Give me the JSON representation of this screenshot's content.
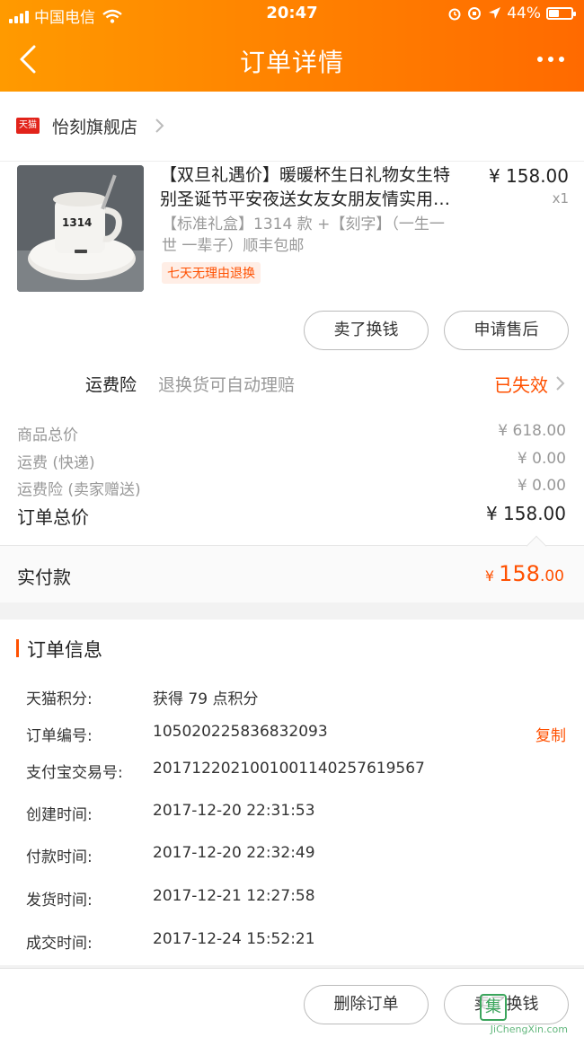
{
  "status_bar": {
    "carrier": "中国电信",
    "time": "20:47",
    "battery": "44%",
    "battery_level": 0.44
  },
  "nav": {
    "title": "订单详情",
    "icons": [
      "back-chevron-icon",
      "more-dots-icon"
    ]
  },
  "shop": {
    "badge": "天猫",
    "name": "怡刻旗舰店"
  },
  "product": {
    "title_line1": "【双旦礼遇价】暖暖杯生日礼物女生特",
    "title_line2": "别圣诞节平安夜送女友女朋友情实用…",
    "price": "¥ 158.00",
    "quantity": "x1",
    "sku_line1": "【标准礼盒】1314 款 +【刻字】（一生一",
    "sku_line2": "世 一辈子）顺丰包邮",
    "tag": "七天无理由退换",
    "mug_label": "1314"
  },
  "item_actions": {
    "sell": "卖了换钱",
    "after_sale": "申请售后"
  },
  "insurance": {
    "label": "运费险",
    "desc": "退换货可自动理赔",
    "status": "已失效"
  },
  "fees": {
    "goods_label": "商品总价",
    "goods_value": "¥ 618.00",
    "shipping_label": "运费 (快递)",
    "shipping_value": "¥ 0.00",
    "insurance_label": "运费险 (卖家赠送)",
    "insurance_value": "¥ 0.00",
    "total_label": "订单总价",
    "total_value": "¥ 158.00"
  },
  "paid": {
    "label": "实付款",
    "currency": "¥ ",
    "integer": "158",
    "decimal": ".00"
  },
  "order_info": {
    "title": "订单信息",
    "rows": [
      {
        "label": "天猫积分:",
        "value": "获得 79 点积分"
      },
      {
        "label": "订单编号:",
        "value": "105020225836832093"
      },
      {
        "label": "支付宝交易号:",
        "value": "2017122021001001140257619567"
      },
      {
        "label": "创建时间:",
        "value": "2017-12-20 22:31:53"
      },
      {
        "label": "付款时间:",
        "value": "2017-12-20 22:32:49"
      },
      {
        "label": "发货时间:",
        "value": "2017-12-21 12:27:58"
      },
      {
        "label": "成交时间:",
        "value": "2017-12-24 15:52:21"
      }
    ],
    "copy": "复制"
  },
  "bottom_actions": {
    "delete": "删除订单",
    "sell": "卖了换钱"
  },
  "watermark": {
    "text": "JiChengXin.com",
    "logo": "集"
  },
  "colors": {
    "accent": "#ff5000",
    "header_start": "#ff9a00",
    "header_end": "#ff6a00",
    "tmall_red": "#e2231a"
  }
}
